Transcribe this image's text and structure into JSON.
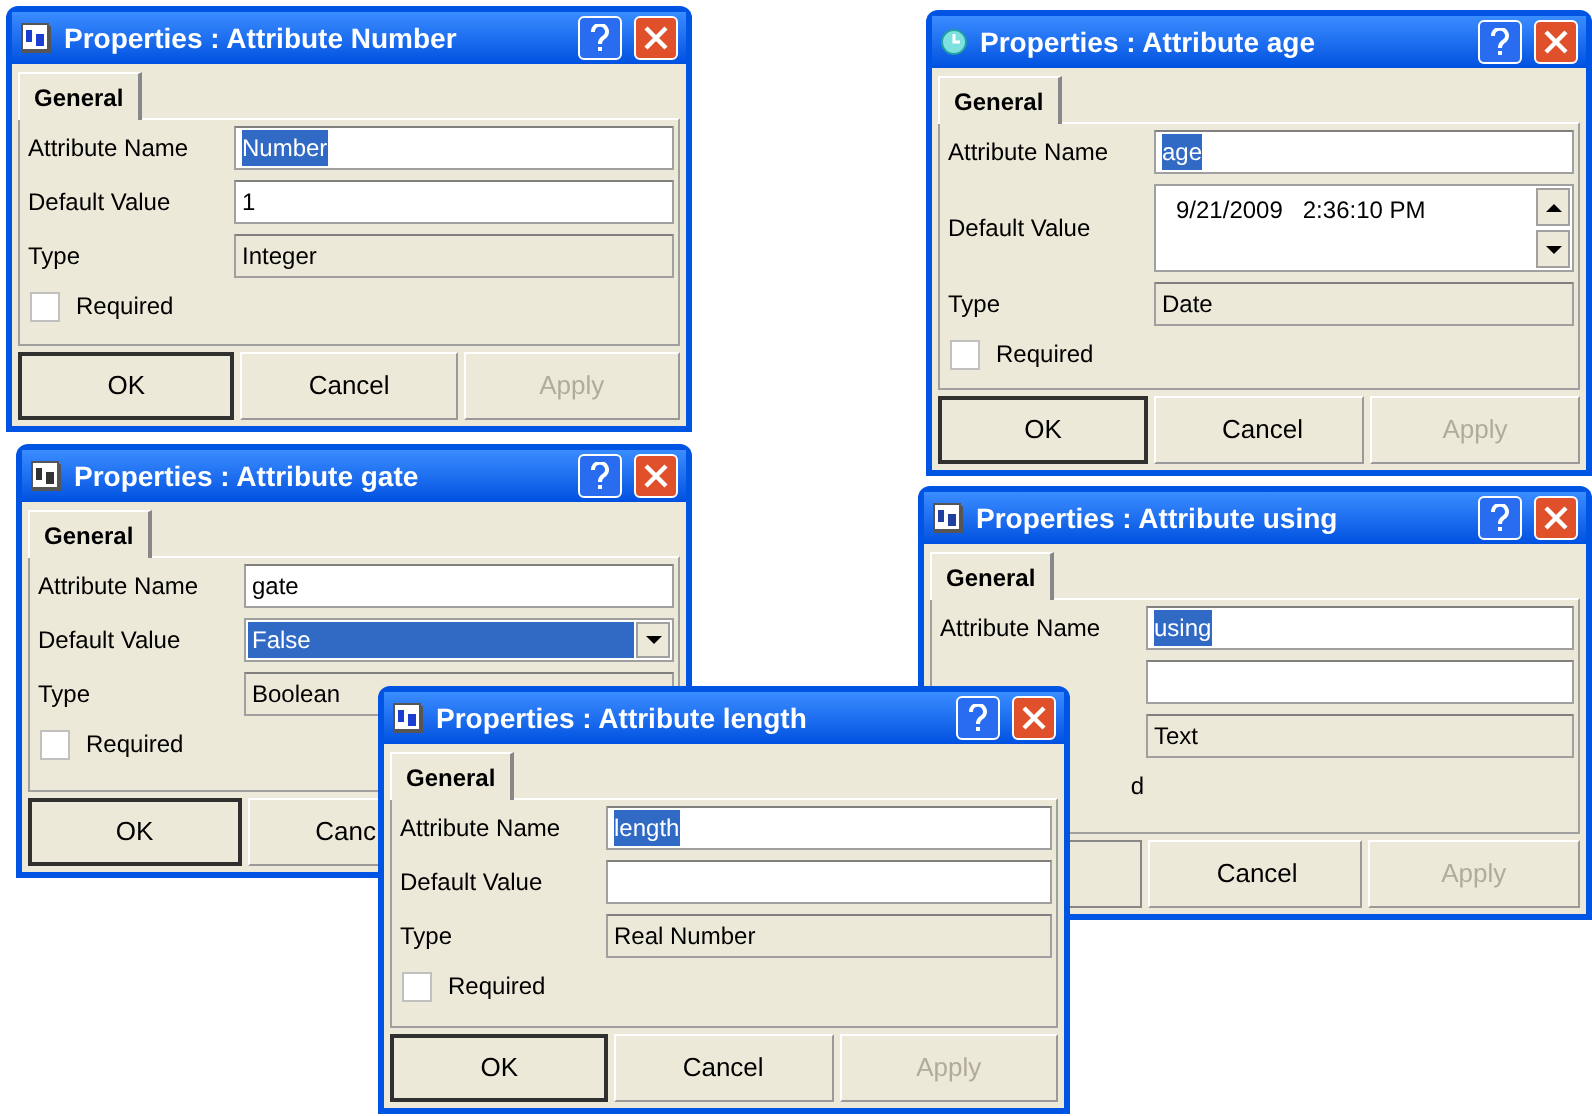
{
  "windows": [
    {
      "title": "Properties : Attribute Number",
      "tab": {
        "label": "General",
        "selected": true
      },
      "name": {
        "label": "Attribute Name",
        "value": "Number",
        "selected": true
      },
      "default": {
        "kind": "text",
        "label": "Default Value",
        "value": "1"
      },
      "type": {
        "label": "Type",
        "value": "Integer"
      },
      "required": {
        "label": "Required",
        "checked": false
      },
      "buttons": [
        {
          "kind": "ok",
          "label": "OK",
          "default": true,
          "disabled": false
        },
        {
          "kind": "cancel",
          "label": "Cancel",
          "default": false,
          "disabled": false
        },
        {
          "kind": "apply",
          "label": "Apply",
          "default": false,
          "disabled": true
        }
      ]
    },
    {
      "title": "Properties : Attribute age",
      "tab": {
        "label": "General",
        "selected": true
      },
      "name": {
        "label": "Attribute Name",
        "value": "age",
        "selected": true
      },
      "default": {
        "kind": "datetime",
        "label": "Default Value",
        "value": "9/21/2009   2:36:10 PM"
      },
      "type": {
        "label": "Type",
        "value": "Date"
      },
      "required": {
        "label": "Required",
        "checked": false
      },
      "buttons": [
        {
          "kind": "ok",
          "label": "OK",
          "default": true,
          "disabled": false
        },
        {
          "kind": "cancel",
          "label": "Cancel",
          "default": false,
          "disabled": false
        },
        {
          "kind": "apply",
          "label": "Apply",
          "default": false,
          "disabled": true
        }
      ]
    },
    {
      "title": "Properties : Attribute using",
      "tab": {
        "label": "General",
        "selected": true
      },
      "name": {
        "label": "Attribute Name",
        "value": "using",
        "selected": true
      },
      "default": {
        "kind": "text"
      },
      "type": {
        "value": "Text"
      },
      "required": {
        "label": "d"
      },
      "buttons": [
        {
          "kind": "cancel",
          "label": "Cancel",
          "default": false,
          "disabled": false
        },
        {
          "kind": "apply",
          "label": "Apply",
          "default": false,
          "disabled": true
        }
      ]
    },
    {
      "title": "Properties : Attribute gate",
      "tab": {
        "label": "General",
        "selected": true
      },
      "name": {
        "label": "Attribute Name",
        "value": "gate",
        "selected": false
      },
      "default": {
        "kind": "dropdown",
        "label": "Default Value",
        "value": "False"
      },
      "type": {
        "label": "Type",
        "value": "Boolean"
      },
      "required": {
        "label": "Required",
        "checked": false
      },
      "buttons": [
        {
          "kind": "ok",
          "label": "OK",
          "default": true,
          "disabled": false
        },
        {
          "kind": "cancel",
          "label": "Canc",
          "default": false
        }
      ]
    },
    {
      "title": "Properties : Attribute length",
      "tab": {
        "label": "General",
        "selected": true
      },
      "name": {
        "label": "Attribute Name",
        "value": "length",
        "selected": true
      },
      "default": {
        "kind": "text",
        "label": "Default Value"
      },
      "type": {
        "label": "Type",
        "value": "Real Number"
      },
      "required": {
        "label": "Required",
        "checked": false
      },
      "buttons": [
        {
          "kind": "ok",
          "label": "OK",
          "default": true,
          "disabled": false
        },
        {
          "kind": "cancel",
          "label": "Cancel",
          "default": false,
          "disabled": false
        },
        {
          "kind": "apply",
          "label": "Apply",
          "default": false,
          "disabled": true
        }
      ]
    }
  ]
}
